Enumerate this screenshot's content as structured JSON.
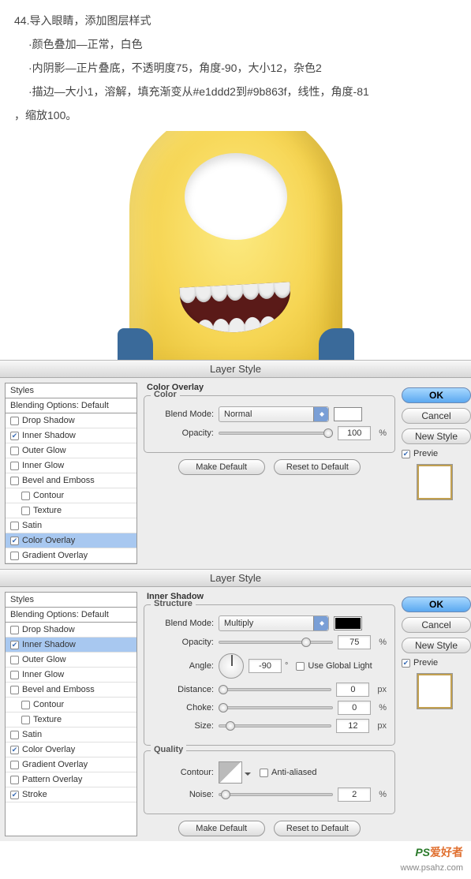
{
  "article": {
    "line1": "44.导入眼睛，添加图层样式",
    "b1": "·颜色叠加—正常，白色",
    "b2": "·内阴影—正片叠底，不透明度75，角度-90，大小12，杂色2",
    "b3": "·描边—大小1，溶解，填充渐变从#e1ddd2到#9b863f，线性，角度-81",
    "b4": "，缩放100。"
  },
  "dialog_title": "Layer Style",
  "styles": {
    "header": "Styles",
    "blending": "Blending Options: Default",
    "drop_shadow": "Drop Shadow",
    "inner_shadow": "Inner Shadow",
    "outer_glow": "Outer Glow",
    "inner_glow": "Inner Glow",
    "bevel": "Bevel and Emboss",
    "contour": "Contour",
    "texture": "Texture",
    "satin": "Satin",
    "color_overlay": "Color Overlay",
    "gradient_overlay": "Gradient Overlay",
    "pattern_overlay": "Pattern Overlay",
    "stroke": "Stroke"
  },
  "labels": {
    "color_overlay": "Color Overlay",
    "color": "Color",
    "blend_mode": "Blend Mode:",
    "opacity": "Opacity:",
    "make_default": "Make Default",
    "reset_default": "Reset to Default",
    "inner_shadow": "Inner Shadow",
    "structure": "Structure",
    "angle": "Angle:",
    "use_global": "Use Global Light",
    "distance": "Distance:",
    "choke": "Choke:",
    "size": "Size:",
    "quality": "Quality",
    "contour_lbl": "Contour:",
    "anti_aliased": "Anti-aliased",
    "noise": "Noise:",
    "deg": "°",
    "px": "px",
    "pct": "%"
  },
  "values": {
    "normal": "Normal",
    "multiply": "Multiply",
    "opacity100": "100",
    "opacity75": "75",
    "angle": "-90",
    "distance": "0",
    "choke": "0",
    "size": "12",
    "noise": "2"
  },
  "right": {
    "ok": "OK",
    "cancel": "Cancel",
    "new_style": "New Style",
    "preview": "Previe"
  },
  "watermark": {
    "ps": "PS",
    "ahz": "爱好者",
    "url": "www.psahz.com"
  }
}
